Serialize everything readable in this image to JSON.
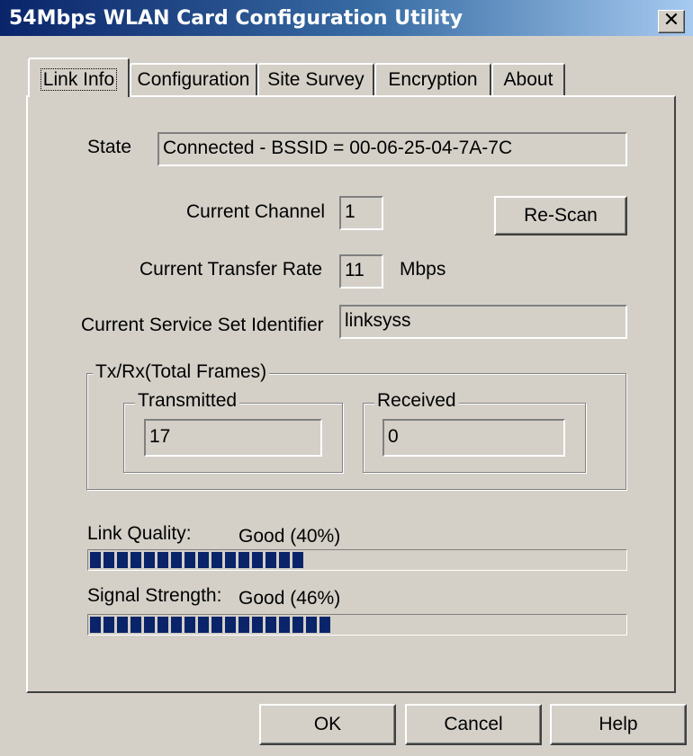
{
  "window": {
    "title": "54Mbps WLAN Card Configuration Utility",
    "close_glyph": "✕",
    "accent": "#0a246a"
  },
  "tabs": [
    {
      "label": "Link Info",
      "active": true
    },
    {
      "label": "Configuration",
      "active": false
    },
    {
      "label": "Site Survey",
      "active": false
    },
    {
      "label": "Encryption",
      "active": false
    },
    {
      "label": "About",
      "active": false
    }
  ],
  "link_info": {
    "state_label": "State",
    "state_value": "Connected - BSSID = 00-06-25-04-7A-7C",
    "channel_label": "Current Channel",
    "channel_value": "1",
    "rescan_label": "Re-Scan",
    "rate_label": "Current Transfer Rate",
    "rate_value": "11",
    "rate_unit": "Mbps",
    "ssid_label": "Current Service Set Identifier",
    "ssid_value": "linksyss",
    "txrx_group_title": "Tx/Rx(Total Frames)",
    "transmitted_title": "Transmitted",
    "transmitted_value": "17",
    "received_title": "Received",
    "received_value": "0",
    "link_quality_label": "Link Quality:",
    "link_quality_value": "Good (40%)",
    "link_quality_percent": 40,
    "signal_strength_label": "Signal Strength:",
    "signal_strength_value": "Good (46%)",
    "signal_strength_percent": 46
  },
  "footer": {
    "ok_label": "OK",
    "cancel_label": "Cancel",
    "help_label": "Help"
  }
}
